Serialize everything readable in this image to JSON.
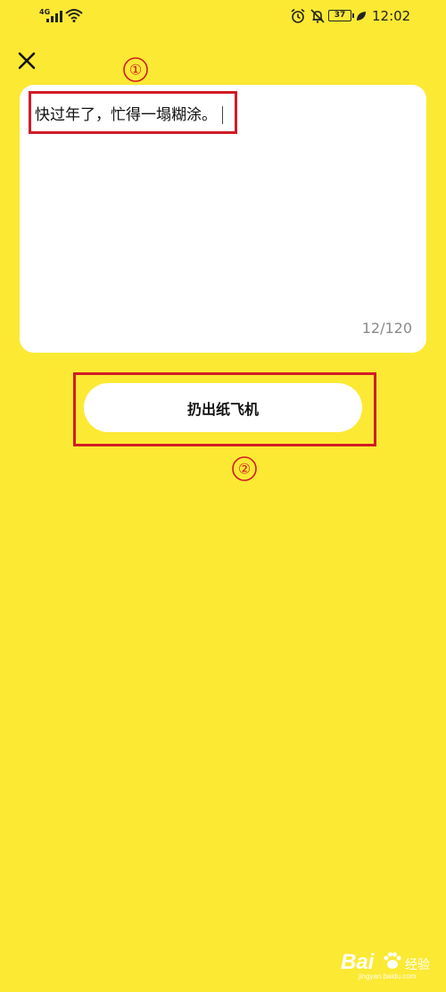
{
  "status_bar": {
    "network_type": "4G",
    "battery_level": "37",
    "time": "12:02"
  },
  "icons": {
    "close": "close-icon",
    "signal": "signal-icon",
    "wifi": "wifi-icon",
    "alarm": "alarm-icon",
    "mute": "mute-icon",
    "battery": "battery-icon",
    "leaf": "power-saving-leaf-icon"
  },
  "note": {
    "text": "快过年了，忙得一塌糊涂。",
    "char_count": "12/120"
  },
  "action": {
    "throw_label": "扔出纸飞机"
  },
  "annotations": {
    "marker_1": "①",
    "marker_2": "②",
    "highlight_color": "#D21B26"
  },
  "watermark": {
    "brand": "Bai",
    "brand_suffix": "经验",
    "url": "jingyan.baidu.com"
  },
  "colors": {
    "background": "#FCE934",
    "card": "#FFFFFF",
    "counter_text": "#8A8A8A"
  }
}
